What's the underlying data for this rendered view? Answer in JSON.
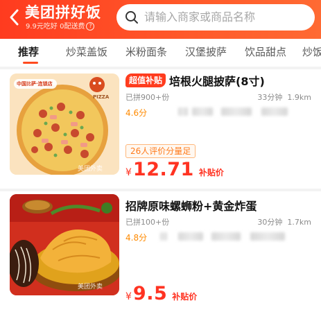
{
  "header": {
    "brand": "美团拼好饭",
    "promo": "9.9元吃好 0配送费",
    "help": "?",
    "search_placeholder": "请输入商家或商品名称"
  },
  "tabs": [
    {
      "label": "推荐",
      "active": true
    },
    {
      "label": "炒菜盖饭",
      "active": false
    },
    {
      "label": "米粉面条",
      "active": false
    },
    {
      "label": "汉堡披萨",
      "active": false
    },
    {
      "label": "饮品甜点",
      "active": false
    },
    {
      "label": "炒饭",
      "active": false
    }
  ],
  "products": [
    {
      "tag": "超值补贴",
      "title": "培根火腿披萨(8寸)",
      "sold": "已拼900+份",
      "time": "33分钟",
      "distance": "1.9km",
      "rating": "4.6分",
      "review_pill": "26人评价分量足",
      "price_symbol": "¥",
      "price": "12.71",
      "price_note": "补贴价",
      "image_caption": "中国比萨·连锁店",
      "image_brand": "PIZZA",
      "watermark": "美团外卖"
    },
    {
      "tag": "",
      "title": "招牌原味螺蛳粉+黄金炸蛋",
      "sold": "已拼100+份",
      "time": "30分钟",
      "distance": "1.7km",
      "rating": "4.8分",
      "review_pill": "",
      "price_symbol": "¥",
      "price": "9.5",
      "price_note": "补贴价",
      "watermark": "美团外卖"
    }
  ],
  "colors": {
    "brand": "#ff4a1f",
    "price": "#ff3322",
    "rating": "#ff8a00"
  }
}
